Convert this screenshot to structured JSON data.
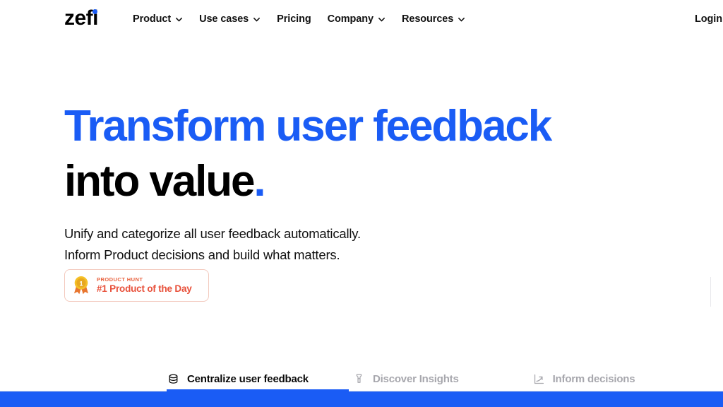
{
  "brand": {
    "logo_text": "zefi",
    "accent_color": "#1a5cf5",
    "logo_dot_icon": "blue-dot-icon"
  },
  "nav": {
    "items": [
      {
        "label": "Product",
        "has_dropdown": true,
        "icon": "chevron-down-icon"
      },
      {
        "label": "Use cases",
        "has_dropdown": true,
        "icon": "chevron-down-icon"
      },
      {
        "label": "Pricing",
        "has_dropdown": false,
        "icon": ""
      },
      {
        "label": "Company",
        "has_dropdown": true,
        "icon": "chevron-down-icon"
      },
      {
        "label": "Resources",
        "has_dropdown": true,
        "icon": "chevron-down-icon"
      }
    ],
    "login_label": "Login"
  },
  "hero": {
    "headline_line1": "Transform user feedback",
    "headline_line2": "into value",
    "headline_period": ".",
    "headline_line1_color": "#1a5cf5",
    "headline_line2_color": "#000000",
    "subhead_line1": "Unify and categorize all user feedback automatically.",
    "subhead_line2": "Inform Product decisions and build what matters."
  },
  "product_hunt_badge": {
    "kicker": "PRODUCT HUNT",
    "title": "#1 Product of the Day",
    "medal_icon": "gold-medal-icon",
    "text_color": "#e8503a",
    "border_color": "#f3c9bd"
  },
  "tabs": {
    "items": [
      {
        "label": "Centralize user feedback",
        "icon": "database-icon",
        "active": true
      },
      {
        "label": "Discover Insights",
        "icon": "flashlight-icon",
        "active": false
      },
      {
        "label": "Inform decisions",
        "icon": "trend-up-icon",
        "active": false
      }
    ],
    "active_index": 0,
    "underline_color": "#1a5cf5"
  },
  "bottom_section": {
    "background_color": "#1a5cf5"
  }
}
